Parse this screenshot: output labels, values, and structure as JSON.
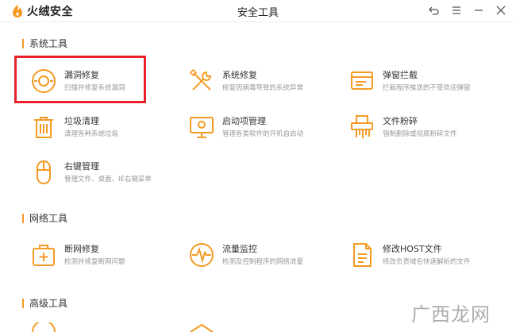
{
  "window": {
    "brand_name": "火绒安全",
    "title": "安全工具"
  },
  "accent_color": "#f59a23",
  "highlight_color": "#e8202a",
  "sections": [
    {
      "title": "系统工具",
      "tools": [
        {
          "name": "漏洞修复",
          "desc": "扫描并修复系统漏洞",
          "icon": "shield-repair-icon"
        },
        {
          "name": "系统修复",
          "desc": "修复因病毒导致的系统异常",
          "icon": "wrench-screwdriver-icon"
        },
        {
          "name": "弹窗拦截",
          "desc": "拦截程序推送的不受欢迎弹窗",
          "icon": "popup-window-icon"
        },
        {
          "name": "垃圾清理",
          "desc": "清理各种系统垃圾",
          "icon": "trash-bin-icon"
        },
        {
          "name": "启动项管理",
          "desc": "管理各类软件的开机自启动",
          "icon": "monitor-startup-icon"
        },
        {
          "name": "文件粉碎",
          "desc": "强制删除或彻底粉碎文件",
          "icon": "shredder-icon"
        },
        {
          "name": "右键管理",
          "desc": "管理文件、桌面、IE右键菜单",
          "icon": "mouse-icon"
        }
      ]
    },
    {
      "title": "网络工具",
      "tools": [
        {
          "name": "断网修复",
          "desc": "检测并修复断网问题",
          "icon": "first-aid-kit-icon"
        },
        {
          "name": "流量监控",
          "desc": "检测及控制程序的网络流量",
          "icon": "traffic-pulse-icon"
        },
        {
          "name": "修改HOST文件",
          "desc": "修改负责域名快速解析的文件",
          "icon": "host-file-icon"
        }
      ]
    },
    {
      "title": "高级工具"
    }
  ],
  "watermark": "广西龙网"
}
